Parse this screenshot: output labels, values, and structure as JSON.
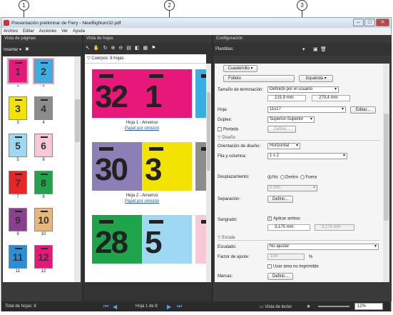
{
  "callouts": [
    "1",
    "2",
    "3"
  ],
  "window": {
    "title": "Presentación preliminar de Fiery - NewBigNum32.pdf",
    "buttons": [
      "–",
      "□",
      "✕"
    ]
  },
  "menu": [
    "Archivo",
    "Editar",
    "Acciones",
    "Ver",
    "Ayuda"
  ],
  "left": {
    "header": "Vista de páginas",
    "insert": "Insertar ▾",
    "pages": [
      {
        "n": "1",
        "label": "1",
        "color": "#e8177a"
      },
      {
        "n": "2",
        "label": "2",
        "color": "#3aaee0"
      },
      {
        "n": "3",
        "label": "3",
        "color": "#f2e300"
      },
      {
        "n": "4",
        "label": "4",
        "color": "#8c8c8c"
      },
      {
        "n": "5",
        "label": "5",
        "color": "#9fd8f2"
      },
      {
        "n": "6",
        "label": "6",
        "color": "#f7c8d8"
      },
      {
        "n": "7",
        "label": "7",
        "color": "#e82525"
      },
      {
        "n": "8",
        "label": "8",
        "color": "#1fa34b"
      },
      {
        "n": "9",
        "label": "9",
        "color": "#8a3f8f"
      },
      {
        "n": "10",
        "label": "10",
        "color": "#e8b87a"
      },
      {
        "n": "11",
        "label": "11",
        "color": "#2a8fd6"
      },
      {
        "n": "12",
        "label": "12",
        "color": "#e8177a"
      }
    ]
  },
  "mid": {
    "header": "Vista de hojas",
    "group": "Cuerpos: 8 hojas",
    "sheets": [
      {
        "left": "32",
        "right": "1",
        "lcolor": "#e8177a",
        "rcolor": "#e8177a",
        "label": "Hoja 1 - Anverso",
        "link": "Papel por omisión",
        "pcolor": "#3aaee0"
      },
      {
        "left": "30",
        "right": "3",
        "lcolor": "#8c7fb6",
        "rcolor": "#f2e300",
        "label": "Hoja 2 - Anverso",
        "link": "Papel por omisión",
        "pcolor": "#8c8c8c"
      },
      {
        "left": "28",
        "right": "5",
        "lcolor": "#1fa34b",
        "rcolor": "#9fd8f2",
        "label": "",
        "link": "",
        "pcolor": "#f7c8d8"
      }
    ]
  },
  "right": {
    "header": "Configuración",
    "presets": "Plantillas:",
    "tabs": {
      "layout": "Cuadernillo",
      "folleto": "Folleto",
      "izq": "Izquierda"
    },
    "finish_label": "Tamaño de terminación:",
    "finish_value": "Definido por el usuario",
    "w": "215,9 mm",
    "h": "279,4 mm",
    "sheet_label": "Hoja:",
    "sheet_value": "11x17",
    "edit": "Editar...",
    "duplex_label": "Dúplex:",
    "duplex_value": "Superior-Superior",
    "cover_label": "Portada",
    "define": "Definir...",
    "design_section": "Diseño",
    "orient_label": "Orientación de diseño:",
    "orient_value": "Horizontal",
    "rowcol_label": "Fila y columna:",
    "rowcol_value": "1 x 2",
    "shift_label": "Desplazamiento:",
    "shift_opts": [
      "No",
      "Dentro",
      "Fuera"
    ],
    "shift_value": "0 mm",
    "sep_label": "Separación:",
    "sep_btn": "Definir...",
    "bleed_label": "Sangrado:",
    "bleed_chk": "Aplicar ambos",
    "bleed_a": "3,175 mm",
    "bleed_b": "3,175 mm",
    "scale_section": "Escala",
    "scaling_label": "Escalado:",
    "scaling_value": "No ajustar",
    "factor_label": "Factor de ajuste:",
    "factor_value": "100",
    "factor_unit": "%",
    "nonprint": "Usar área no imprimible",
    "marks_label": "Marcas:",
    "marks_btn": "Definir..."
  },
  "status": {
    "total": "Total de hojas: 8",
    "page": "Hoja 1 de 8",
    "reader": "Vista de lector",
    "zoom": "12%"
  }
}
